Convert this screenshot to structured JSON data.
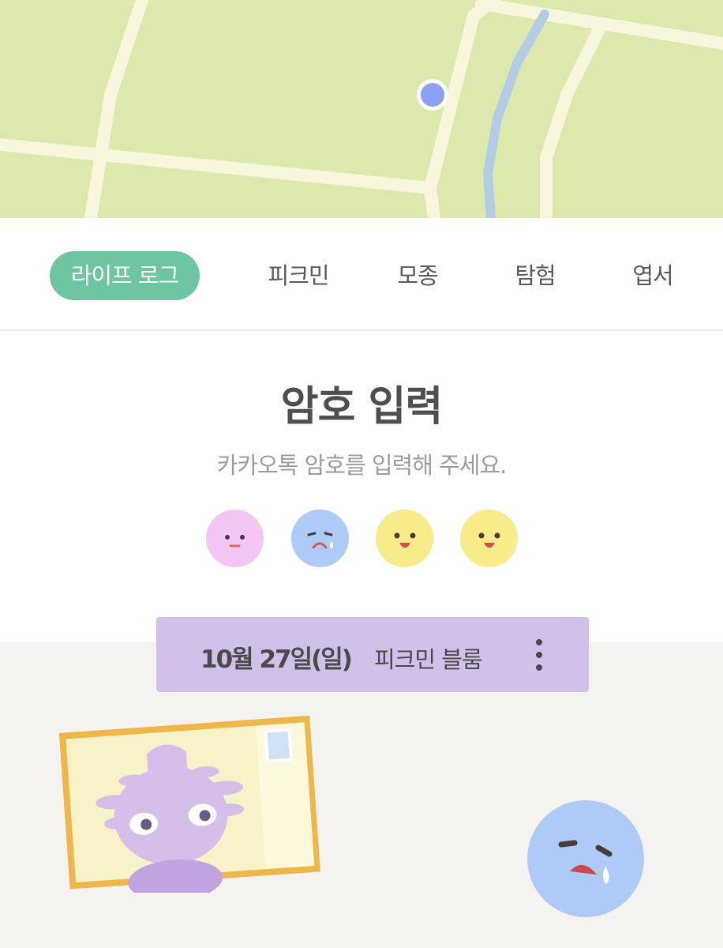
{
  "tabs": [
    {
      "label": "라이프 로그",
      "active": true
    },
    {
      "label": "피크민",
      "active": false
    },
    {
      "label": "모종",
      "active": false
    },
    {
      "label": "탐험",
      "active": false
    },
    {
      "label": "엽서",
      "active": false
    }
  ],
  "passcode": {
    "title": "암호 입력",
    "subtitle": "카카오톡 암호를 입력해 주세요.",
    "dots": [
      {
        "mood": "neutral-face-icon",
        "color": "#f4c6f4"
      },
      {
        "mood": "crying-face-icon",
        "color": "#aecbf7"
      },
      {
        "mood": "happy-face-icon",
        "color": "#f8ec8a"
      },
      {
        "mood": "happy-face-icon",
        "color": "#f8ec8a"
      }
    ]
  },
  "log": {
    "date": "10월 27일(일)",
    "label": "피크민 블룸"
  },
  "colors": {
    "accent": "#6dc6a0",
    "map_land": "#dde8ac",
    "map_road": "#f7f6dc",
    "map_river": "#b3cce6",
    "location_dot": "#8aa1f5",
    "banner": "#d1c1ea",
    "postcard_frame": "#efb64a",
    "background": "#f4f3ef"
  }
}
